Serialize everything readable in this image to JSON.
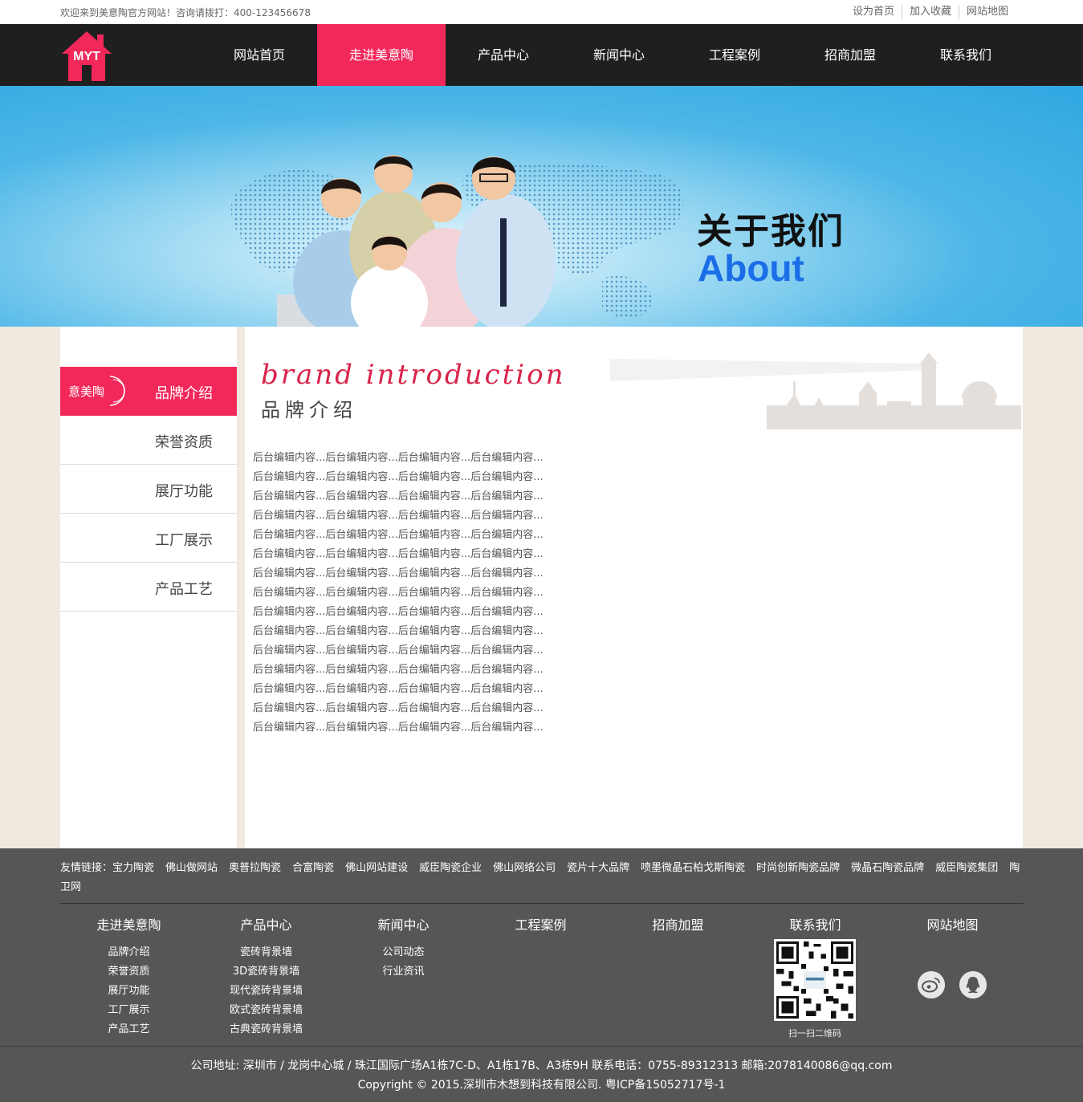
{
  "topbar": {
    "welcome": "欢迎来到美意陶官方网站！咨询请拨打：400-123456678",
    "links": [
      "设为首页",
      "加入收藏",
      "网站地图"
    ]
  },
  "logo": {
    "text": "MYT",
    "icon": "house-logo-icon"
  },
  "nav": {
    "items": [
      "网站首页",
      "走进美意陶",
      "产品中心",
      "新闻中心",
      "工程案例",
      "招商加盟",
      "联系我们"
    ],
    "active_index": 1
  },
  "banner": {
    "title_cn": "关于我们",
    "title_en": "About"
  },
  "sidebar": {
    "emblem_text": "意美陶",
    "items": [
      "品牌介绍",
      "荣誉资质",
      "展厅功能",
      "工厂展示",
      "产品工艺"
    ],
    "active_index": 0
  },
  "main": {
    "heading_en": "brand introduction",
    "heading_cn": "品牌介绍",
    "content_lines": [
      "后台编辑内容...后台编辑内容...后台编辑内容...后台编辑内容...",
      "后台编辑内容...后台编辑内容...后台编辑内容...后台编辑内容...",
      "后台编辑内容...后台编辑内容...后台编辑内容...后台编辑内容...",
      "后台编辑内容...后台编辑内容...后台编辑内容...后台编辑内容...",
      "后台编辑内容...后台编辑内容...后台编辑内容...后台编辑内容...",
      "后台编辑内容...后台编辑内容...后台编辑内容...后台编辑内容...",
      "后台编辑内容...后台编辑内容...后台编辑内容...后台编辑内容...",
      "后台编辑内容...后台编辑内容...后台编辑内容...后台编辑内容...",
      "后台编辑内容...后台编辑内容...后台编辑内容...后台编辑内容...",
      "后台编辑内容...后台编辑内容...后台编辑内容...后台编辑内容...",
      "后台编辑内容...后台编辑内容...后台编辑内容...后台编辑内容...",
      "后台编辑内容...后台编辑内容...后台编辑内容...后台编辑内容...",
      "后台编辑内容...后台编辑内容...后台编辑内容...后台编辑内容...",
      "后台编辑内容...后台编辑内容...后台编辑内容...后台编辑内容...",
      "后台编辑内容...后台编辑内容...后台编辑内容...后台编辑内容..."
    ]
  },
  "footer": {
    "friend_label": "友情链接：",
    "friend_links": [
      "宝力陶瓷",
      "佛山做网站",
      "奥普拉陶瓷",
      "合富陶瓷",
      "佛山网站建设",
      "威臣陶瓷企业",
      "佛山网络公司",
      "瓷片十大品牌",
      "喷墨微晶石柏戈斯陶瓷",
      "时尚创新陶瓷品牌",
      "微晶石陶瓷品牌",
      "威臣陶瓷集团",
      "陶卫网"
    ],
    "columns": [
      {
        "title": "走进美意陶",
        "items": [
          "品牌介绍",
          "荣誉资质",
          "展厅功能",
          "工厂展示",
          "产品工艺"
        ]
      },
      {
        "title": "产品中心",
        "items": [
          "瓷砖背景墙",
          "3D瓷砖背景墙",
          "现代瓷砖背景墙",
          "欧式瓷砖背景墙",
          "古典瓷砖背景墙"
        ]
      },
      {
        "title": "新闻中心",
        "items": [
          "公司动态",
          "行业资讯"
        ]
      },
      {
        "title": "工程案例",
        "items": []
      },
      {
        "title": "招商加盟",
        "items": []
      },
      {
        "title": "联系我们",
        "items": []
      },
      {
        "title": "网站地图",
        "items": []
      }
    ],
    "qr_caption": "扫一扫二维码",
    "social_icons": [
      "weibo-icon",
      "qq-icon"
    ],
    "address": "公司地址: 深圳市 / 龙岗中心城 / 珠江国际广场A1栋7C-D、A1栋17B、A3栋9H 联系电话：0755-89312313 邮箱:2078140086@qq.com",
    "copyright": "Copyright © 2015.深圳市木想到科技有限公司. 粤ICP备15052717号-1"
  },
  "colors": {
    "accent": "#f2285a",
    "nav_bg": "#1f1f1f",
    "footer_bg": "#565656",
    "about_blue": "#1c6ee8"
  }
}
